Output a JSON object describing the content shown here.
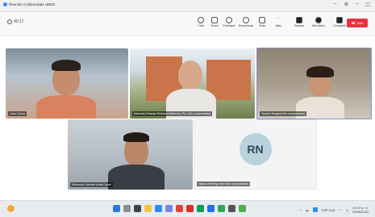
{
  "window": {
    "title": "Reunión Colaboradas UDES"
  },
  "toolbar": {
    "timer": "40:17",
    "buttons": [
      {
        "label": "Chat",
        "icon": "chat-icon"
      },
      {
        "label": "Seres",
        "icon": "people-icon"
      },
      {
        "label": "Participar",
        "icon": "hand-icon"
      },
      {
        "label": "Reaccionar",
        "icon": "smile-icon"
      },
      {
        "label": "Vista",
        "icon": "view-icon"
      },
      {
        "label": "Más",
        "icon": "more-icon"
      },
      {
        "label": "Cámara",
        "icon": "camera-icon"
      },
      {
        "label": "Micrófono",
        "icon": "mic-icon"
      },
      {
        "label": "Compartir",
        "icon": "share-icon"
      }
    ],
    "leave_label": "Salir"
  },
  "participants": [
    {
      "name": "Juan Carlos"
    },
    {
      "name": "Manuela Orlando Pedroza Mahecha, Pro. (No comprobado)"
    },
    {
      "name": "Sandra Vergara (No comprobado)"
    },
    {
      "name": "Edmundo Germán Arias Dacal"
    },
    {
      "name": "raissa rendring nieve (No comprobado)",
      "initials": "RN"
    }
  ],
  "tray": {
    "lang": "ESP LAA",
    "time": "13:07 p. m.",
    "date": "20/06/2023"
  },
  "colors": {
    "leave": "#e8313f",
    "active_border": "#8a8fd6",
    "avatar": "#b9d2dc"
  }
}
